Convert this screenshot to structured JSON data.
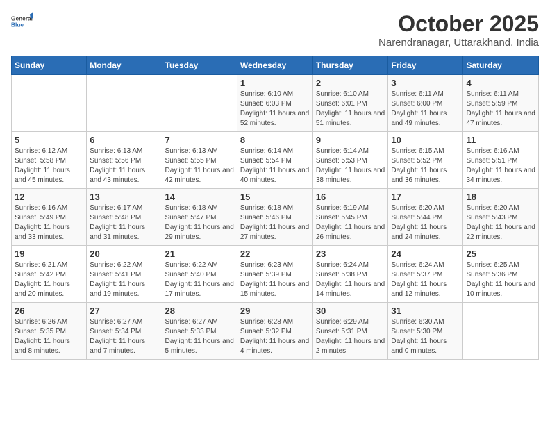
{
  "logo": {
    "general": "General",
    "blue": "Blue"
  },
  "title": "October 2025",
  "subtitle": "Narendranagar, Uttarakhand, India",
  "weekdays": [
    "Sunday",
    "Monday",
    "Tuesday",
    "Wednesday",
    "Thursday",
    "Friday",
    "Saturday"
  ],
  "weeks": [
    [
      {
        "day": "",
        "sunrise": "",
        "sunset": "",
        "daylight": ""
      },
      {
        "day": "",
        "sunrise": "",
        "sunset": "",
        "daylight": ""
      },
      {
        "day": "",
        "sunrise": "",
        "sunset": "",
        "daylight": ""
      },
      {
        "day": "1",
        "sunrise": "Sunrise: 6:10 AM",
        "sunset": "Sunset: 6:03 PM",
        "daylight": "Daylight: 11 hours and 52 minutes."
      },
      {
        "day": "2",
        "sunrise": "Sunrise: 6:10 AM",
        "sunset": "Sunset: 6:01 PM",
        "daylight": "Daylight: 11 hours and 51 minutes."
      },
      {
        "day": "3",
        "sunrise": "Sunrise: 6:11 AM",
        "sunset": "Sunset: 6:00 PM",
        "daylight": "Daylight: 11 hours and 49 minutes."
      },
      {
        "day": "4",
        "sunrise": "Sunrise: 6:11 AM",
        "sunset": "Sunset: 5:59 PM",
        "daylight": "Daylight: 11 hours and 47 minutes."
      }
    ],
    [
      {
        "day": "5",
        "sunrise": "Sunrise: 6:12 AM",
        "sunset": "Sunset: 5:58 PM",
        "daylight": "Daylight: 11 hours and 45 minutes."
      },
      {
        "day": "6",
        "sunrise": "Sunrise: 6:13 AM",
        "sunset": "Sunset: 5:56 PM",
        "daylight": "Daylight: 11 hours and 43 minutes."
      },
      {
        "day": "7",
        "sunrise": "Sunrise: 6:13 AM",
        "sunset": "Sunset: 5:55 PM",
        "daylight": "Daylight: 11 hours and 42 minutes."
      },
      {
        "day": "8",
        "sunrise": "Sunrise: 6:14 AM",
        "sunset": "Sunset: 5:54 PM",
        "daylight": "Daylight: 11 hours and 40 minutes."
      },
      {
        "day": "9",
        "sunrise": "Sunrise: 6:14 AM",
        "sunset": "Sunset: 5:53 PM",
        "daylight": "Daylight: 11 hours and 38 minutes."
      },
      {
        "day": "10",
        "sunrise": "Sunrise: 6:15 AM",
        "sunset": "Sunset: 5:52 PM",
        "daylight": "Daylight: 11 hours and 36 minutes."
      },
      {
        "day": "11",
        "sunrise": "Sunrise: 6:16 AM",
        "sunset": "Sunset: 5:51 PM",
        "daylight": "Daylight: 11 hours and 34 minutes."
      }
    ],
    [
      {
        "day": "12",
        "sunrise": "Sunrise: 6:16 AM",
        "sunset": "Sunset: 5:49 PM",
        "daylight": "Daylight: 11 hours and 33 minutes."
      },
      {
        "day": "13",
        "sunrise": "Sunrise: 6:17 AM",
        "sunset": "Sunset: 5:48 PM",
        "daylight": "Daylight: 11 hours and 31 minutes."
      },
      {
        "day": "14",
        "sunrise": "Sunrise: 6:18 AM",
        "sunset": "Sunset: 5:47 PM",
        "daylight": "Daylight: 11 hours and 29 minutes."
      },
      {
        "day": "15",
        "sunrise": "Sunrise: 6:18 AM",
        "sunset": "Sunset: 5:46 PM",
        "daylight": "Daylight: 11 hours and 27 minutes."
      },
      {
        "day": "16",
        "sunrise": "Sunrise: 6:19 AM",
        "sunset": "Sunset: 5:45 PM",
        "daylight": "Daylight: 11 hours and 26 minutes."
      },
      {
        "day": "17",
        "sunrise": "Sunrise: 6:20 AM",
        "sunset": "Sunset: 5:44 PM",
        "daylight": "Daylight: 11 hours and 24 minutes."
      },
      {
        "day": "18",
        "sunrise": "Sunrise: 6:20 AM",
        "sunset": "Sunset: 5:43 PM",
        "daylight": "Daylight: 11 hours and 22 minutes."
      }
    ],
    [
      {
        "day": "19",
        "sunrise": "Sunrise: 6:21 AM",
        "sunset": "Sunset: 5:42 PM",
        "daylight": "Daylight: 11 hours and 20 minutes."
      },
      {
        "day": "20",
        "sunrise": "Sunrise: 6:22 AM",
        "sunset": "Sunset: 5:41 PM",
        "daylight": "Daylight: 11 hours and 19 minutes."
      },
      {
        "day": "21",
        "sunrise": "Sunrise: 6:22 AM",
        "sunset": "Sunset: 5:40 PM",
        "daylight": "Daylight: 11 hours and 17 minutes."
      },
      {
        "day": "22",
        "sunrise": "Sunrise: 6:23 AM",
        "sunset": "Sunset: 5:39 PM",
        "daylight": "Daylight: 11 hours and 15 minutes."
      },
      {
        "day": "23",
        "sunrise": "Sunrise: 6:24 AM",
        "sunset": "Sunset: 5:38 PM",
        "daylight": "Daylight: 11 hours and 14 minutes."
      },
      {
        "day": "24",
        "sunrise": "Sunrise: 6:24 AM",
        "sunset": "Sunset: 5:37 PM",
        "daylight": "Daylight: 11 hours and 12 minutes."
      },
      {
        "day": "25",
        "sunrise": "Sunrise: 6:25 AM",
        "sunset": "Sunset: 5:36 PM",
        "daylight": "Daylight: 11 hours and 10 minutes."
      }
    ],
    [
      {
        "day": "26",
        "sunrise": "Sunrise: 6:26 AM",
        "sunset": "Sunset: 5:35 PM",
        "daylight": "Daylight: 11 hours and 8 minutes."
      },
      {
        "day": "27",
        "sunrise": "Sunrise: 6:27 AM",
        "sunset": "Sunset: 5:34 PM",
        "daylight": "Daylight: 11 hours and 7 minutes."
      },
      {
        "day": "28",
        "sunrise": "Sunrise: 6:27 AM",
        "sunset": "Sunset: 5:33 PM",
        "daylight": "Daylight: 11 hours and 5 minutes."
      },
      {
        "day": "29",
        "sunrise": "Sunrise: 6:28 AM",
        "sunset": "Sunset: 5:32 PM",
        "daylight": "Daylight: 11 hours and 4 minutes."
      },
      {
        "day": "30",
        "sunrise": "Sunrise: 6:29 AM",
        "sunset": "Sunset: 5:31 PM",
        "daylight": "Daylight: 11 hours and 2 minutes."
      },
      {
        "day": "31",
        "sunrise": "Sunrise: 6:30 AM",
        "sunset": "Sunset: 5:30 PM",
        "daylight": "Daylight: 11 hours and 0 minutes."
      },
      {
        "day": "",
        "sunrise": "",
        "sunset": "",
        "daylight": ""
      }
    ]
  ]
}
